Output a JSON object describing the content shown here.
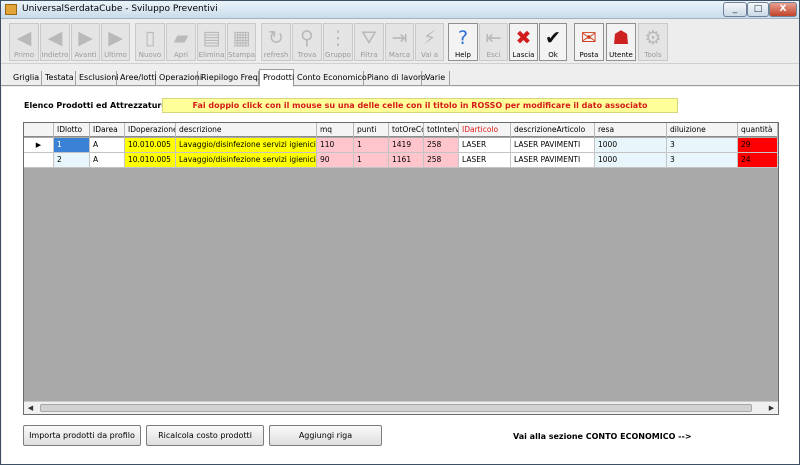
{
  "window": {
    "title": "UniversalSerdataCube - Sviluppo Preventivi",
    "minimize_glyph": "_",
    "maximize_glyph": "□",
    "close_glyph": "X"
  },
  "toolbar": [
    {
      "label": "Primo",
      "icon": "◀",
      "icon_name": "first-arrow-icon",
      "enabled": false
    },
    {
      "label": "Indietro",
      "icon": "◀",
      "icon_name": "back-arrow-icon",
      "enabled": false
    },
    {
      "label": "Avanti",
      "icon": "▶",
      "icon_name": "forward-arrow-icon",
      "enabled": false
    },
    {
      "label": "Ultimo",
      "icon": "▶",
      "icon_name": "last-arrow-icon",
      "enabled": false
    },
    {
      "label": "Nuovo",
      "icon": "▯",
      "icon_name": "new-document-icon",
      "enabled": false
    },
    {
      "label": "Apri",
      "icon": "▰",
      "icon_name": "open-folder-icon",
      "enabled": false
    },
    {
      "label": "Elimina",
      "icon": "▤",
      "icon_name": "delete-bin-icon",
      "enabled": false
    },
    {
      "label": "Stampa",
      "icon": "▦",
      "icon_name": "printer-icon",
      "enabled": false
    },
    {
      "label": "refresh",
      "icon": "↻",
      "icon_name": "refresh-icon",
      "enabled": false
    },
    {
      "label": "Trova",
      "icon": "⚲",
      "icon_name": "binoculars-icon",
      "enabled": false
    },
    {
      "label": "Gruppo",
      "icon": "⋮",
      "icon_name": "group-icon",
      "enabled": false
    },
    {
      "label": "Filtra",
      "icon": "⛛",
      "icon_name": "filter-icon",
      "enabled": false
    },
    {
      "label": "Marca",
      "icon": "⇥",
      "icon_name": "mark-icon",
      "enabled": false
    },
    {
      "label": "Vai a",
      "icon": "⚡",
      "icon_name": "goto-lightning-icon",
      "enabled": false
    },
    {
      "label": "Help",
      "icon": "?",
      "icon_name": "help-icon",
      "enabled": true,
      "cls": "help"
    },
    {
      "label": "Esci",
      "icon": "⇤",
      "icon_name": "exit-door-icon",
      "enabled": false
    },
    {
      "label": "Lascia",
      "icon": "✖",
      "icon_name": "release-icon",
      "enabled": true,
      "cls": "lascia"
    },
    {
      "label": "Ok",
      "icon": "✔",
      "icon_name": "ok-check-icon",
      "enabled": true,
      "cls": "ok"
    },
    {
      "label": "Posta",
      "icon": "✉",
      "icon_name": "mail-icon",
      "enabled": true,
      "cls": "posta"
    },
    {
      "label": "Utente",
      "icon": "☗",
      "icon_name": "user-icon",
      "enabled": true,
      "cls": "utente"
    },
    {
      "label": "Tools",
      "icon": "⚙",
      "icon_name": "tools-icon",
      "enabled": false
    }
  ],
  "tabs": [
    {
      "label": "Griglia"
    },
    {
      "label": "Testata"
    },
    {
      "label": "Esclusioni"
    },
    {
      "label": "Aree/lotti"
    },
    {
      "label": "Operazioni"
    },
    {
      "label": "Riepilogo Freq."
    },
    {
      "label": "Prodotti",
      "active": true
    },
    {
      "label": "Conto Economico"
    },
    {
      "label": "Piano di lavoro"
    },
    {
      "label": "Varie"
    }
  ],
  "panel": {
    "section_title": "Elenco Prodotti ed Attrezzature",
    "hint": "Fai doppio click con il mouse su una delle celle con il titolo in ROSSO per modificare il dato associato"
  },
  "grid": {
    "columns": [
      "IDlotto",
      "IDarea",
      "IDoperazione",
      "descrizione",
      "mq",
      "punti",
      "totOreCo",
      "totInterv",
      "IDarticolo",
      "descrizioneArticolo",
      "resa",
      "diluizione",
      "quantità"
    ],
    "red_columns": [
      "IDarticolo"
    ],
    "current_row_marker": "▶",
    "rows": [
      {
        "current": true,
        "cells": [
          "1",
          "A",
          "10.010.005",
          "Lavaggio/disinfezione servizi igienici",
          "110",
          "1",
          "1419",
          "258",
          "LASER",
          "LASER PAVIMENTI",
          "1000",
          "3",
          "29"
        ]
      },
      {
        "current": false,
        "cells": [
          "2",
          "A",
          "10.010.005",
          "Lavaggio/disinfezione servizi igienici",
          "90",
          "1",
          "1161",
          "258",
          "LASER",
          "LASER PAVIMENTI",
          "1000",
          "3",
          "24"
        ]
      }
    ],
    "scroll_left": "◀",
    "scroll_right": "▶"
  },
  "buttons": {
    "import": "Importa prodotti da profilo",
    "recalc": "Ricalcola costo prodotti",
    "add_row": "Aggiungi riga"
  },
  "goto_link": "Vai alla sezione CONTO ECONOMICO -->"
}
